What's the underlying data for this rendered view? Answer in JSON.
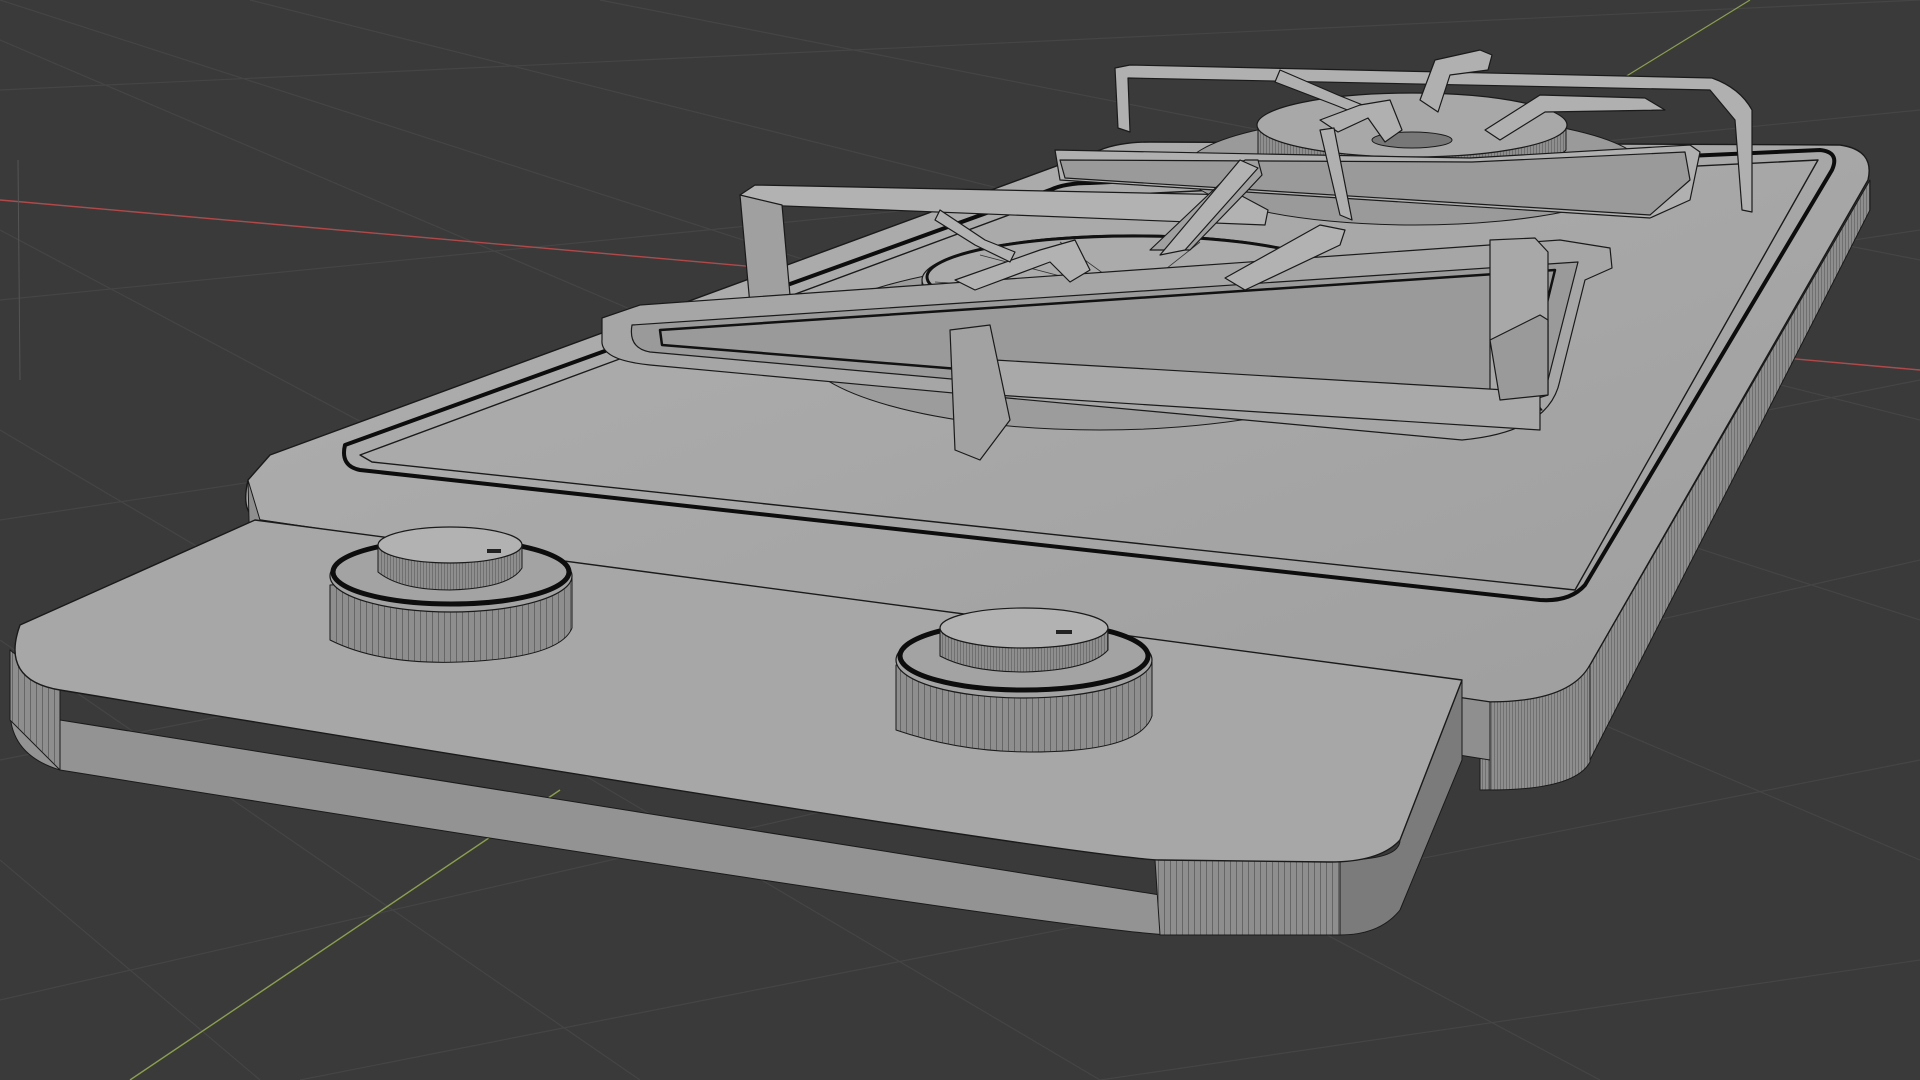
{
  "viewport": {
    "background": "#3a3a3a",
    "grid_color": "#4a4a4a",
    "x_axis_color": "#b04a4a",
    "y_axis_color": "#8aa04a",
    "z_axis_color": "#6a6a6a",
    "shading": "solid",
    "overlay": "wireframe"
  },
  "model": {
    "object": "gas-stove",
    "surface_color": "#a5a5a5",
    "edge_color": "#1a1a1a",
    "burner_count": 2,
    "knob_count": 2,
    "grate_count": 2
  }
}
